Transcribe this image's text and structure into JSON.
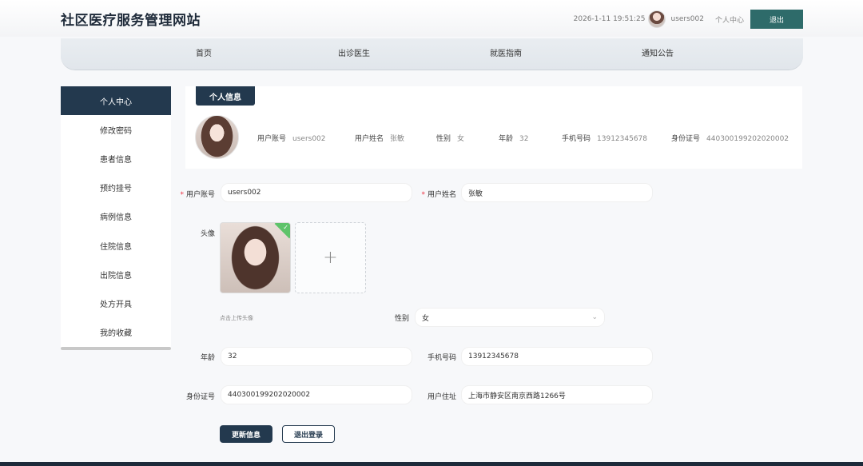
{
  "header": {
    "title": "社区医疗服务管理网站",
    "datetime": "2026-1-11 19:51:25",
    "username": "users002",
    "personal_center": "个人中心",
    "logout": "退出"
  },
  "nav": {
    "items": [
      "首页",
      "出诊医生",
      "就医指南",
      "通知公告"
    ]
  },
  "sidebar": {
    "items": [
      "个人中心",
      "修改密码",
      "患者信息",
      "预约挂号",
      "病例信息",
      "住院信息",
      "出院信息",
      "处方开具",
      "我的收藏"
    ],
    "active": "个人中心"
  },
  "info": {
    "tab": "个人信息",
    "fields": [
      {
        "label": "用户账号",
        "value": "users002"
      },
      {
        "label": "用户姓名",
        "value": "张敏"
      },
      {
        "label": "性别",
        "value": "女"
      },
      {
        "label": "年龄",
        "value": "32"
      },
      {
        "label": "手机号码",
        "value": "13912345678"
      },
      {
        "label": "身份证号",
        "value": "440300199202020002"
      }
    ]
  },
  "form": {
    "account_label": "用户账号",
    "account_value": "users002",
    "name_label": "用户姓名",
    "name_value": "张敏",
    "avatar_label": "头像",
    "upload_plus": "+",
    "upload_hint": "点击上传头像",
    "gender_label": "性别",
    "gender_value": "女",
    "age_label": "年龄",
    "age_value": "32",
    "phone_label": "手机号码",
    "phone_value": "13912345678",
    "id_label": "身份证号",
    "id_value": "440300199202020002",
    "address_label": "用户住址",
    "address_value": "上海市静安区南京西路1266号",
    "required_mark": "*",
    "update_button": "更新信息",
    "logout_button": "退出登录"
  }
}
